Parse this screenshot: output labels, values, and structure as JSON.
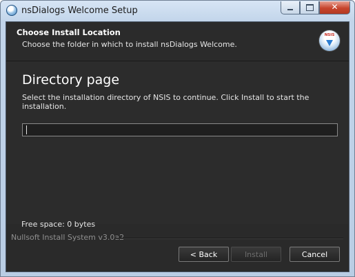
{
  "window": {
    "title": "nsDialogs Welcome Setup",
    "controls": [
      "minimize",
      "maximize",
      "close"
    ]
  },
  "header": {
    "title": "Choose Install Location",
    "subtitle": "Choose the folder in which to install nsDialogs Welcome.",
    "icon": "nsis-installer-icon",
    "icon_label": "NSIS"
  },
  "page": {
    "title": "Directory page",
    "description": "Select the installation directory of NSIS to continue. Click Install to start the installation.",
    "directory_input": {
      "value": "",
      "placeholder": ""
    },
    "free_space": "Free space: 0 bytes"
  },
  "branding": "Nullsoft Install System v3.0a2",
  "buttons": {
    "back": "< Back",
    "install": "Install",
    "cancel": "Cancel"
  },
  "colors": {
    "background": "#2b2b2b",
    "text": "#ffffff",
    "disabled_text": "#6d6d6d",
    "close_button": "#c7442c"
  }
}
